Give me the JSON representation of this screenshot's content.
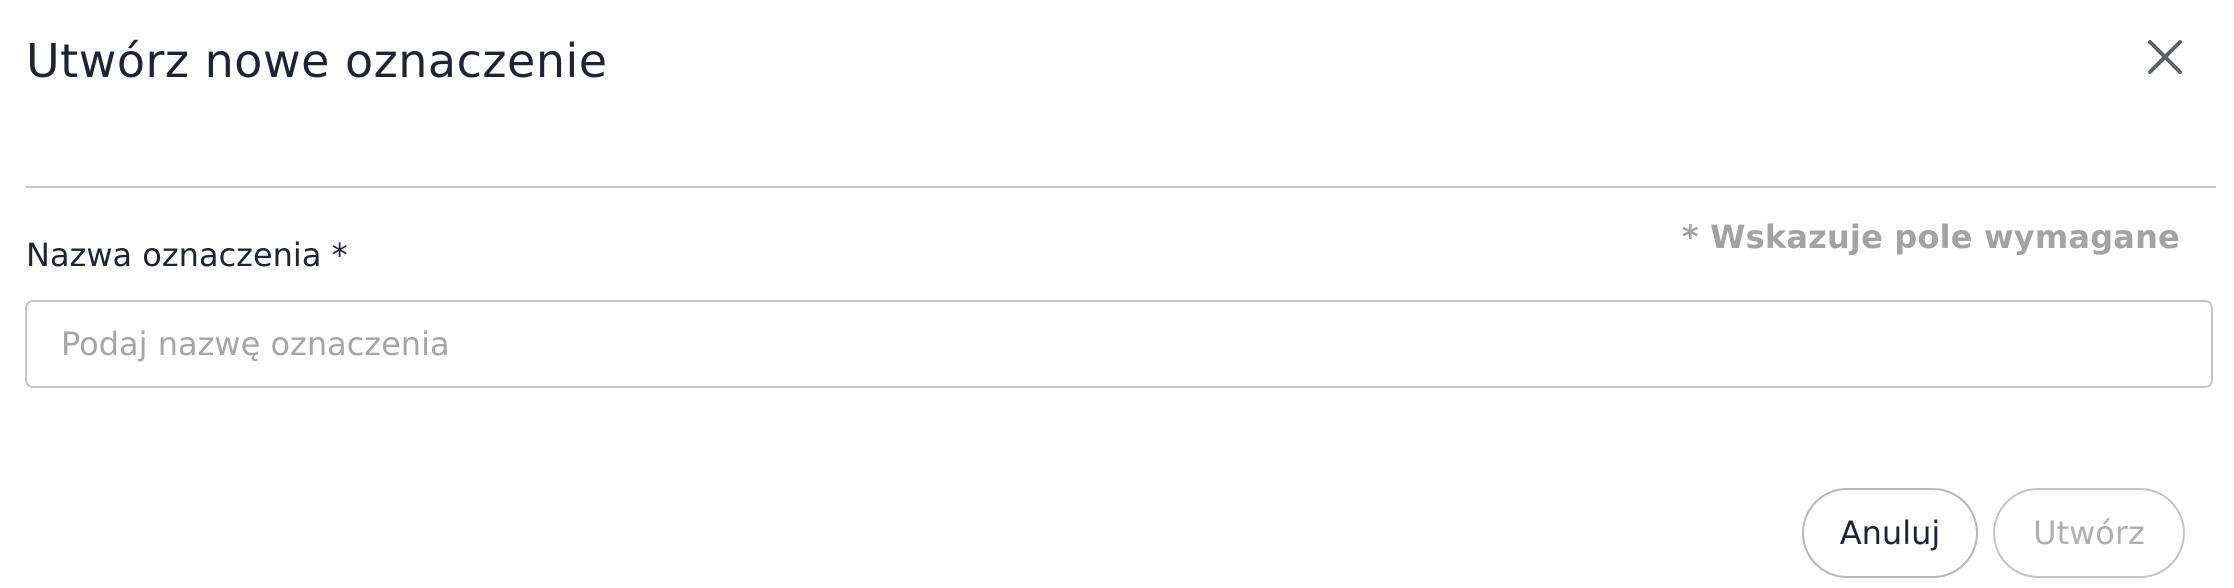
{
  "dialog": {
    "title": "Utwórz nowe oznaczenie",
    "close_icon": "close-icon",
    "required_note": "* Wskazuje pole wymagane",
    "field": {
      "label": "Nazwa oznaczenia *",
      "value": "",
      "placeholder": "Podaj nazwę oznaczenia"
    },
    "buttons": {
      "cancel_label": "Anuluj",
      "create_label": "Utwórz",
      "create_enabled": false
    }
  },
  "colors": {
    "text": "#1f2430",
    "muted": "#a3a3a3",
    "border": "#c6c6c6"
  }
}
